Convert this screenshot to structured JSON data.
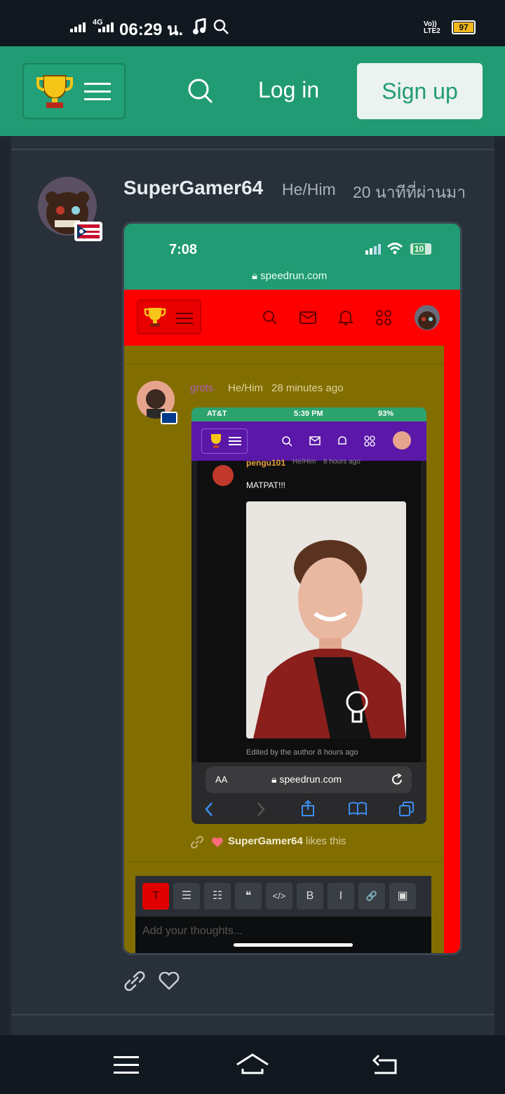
{
  "status_bar": {
    "network": "4G",
    "time": "06:29 น.",
    "volte": "Vo)) LTE2",
    "battery": "97"
  },
  "header": {
    "login_label": "Log in",
    "signup_label": "Sign up"
  },
  "post": {
    "username": "SuperGamer64",
    "pronouns": "He/Him",
    "time_ago": "20 นาทีที่ผ่านมา"
  },
  "embedded": {
    "time": "7:08",
    "battery": "10",
    "url": "speedrun.com",
    "comment": {
      "username": "grots",
      "pronouns": "He/Him",
      "time_ago": "28 minutes ago"
    },
    "nested": {
      "carrier": "AT&T",
      "time": "5:39 PM",
      "battery": "93%",
      "commenter": "pengu101",
      "pronouns": "He/Him",
      "time_ago": "8 hours ago",
      "message": "MATPAT!!!",
      "edited_note": "Edited by the author 8 hours ago",
      "text_size_label": "AA",
      "url": "speedrun.com"
    },
    "likes": {
      "user": "SuperGamer64",
      "suffix": "likes this"
    },
    "editor": {
      "placeholder": "Add your thoughts...",
      "toolbar": [
        "T",
        "☰",
        "☷",
        "❝",
        "</>",
        "B",
        "I",
        "🔗",
        "▣"
      ]
    }
  },
  "colors": {
    "brand_green": "#219b73",
    "red_nav": "#ff0000",
    "purple_nav": "#5a17a8",
    "olive": "#826e00"
  }
}
